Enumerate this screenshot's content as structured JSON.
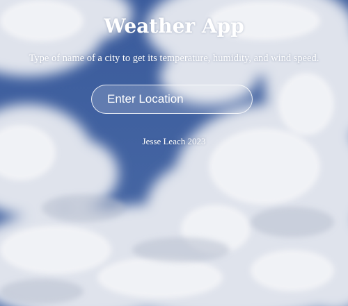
{
  "app": {
    "title": "Weather App",
    "subtitle": "Type of name of a city to get its temperature, humidity, and wind speed.",
    "footer_credit": "Jesse Leach 2023"
  },
  "search": {
    "placeholder": "Enter Location",
    "value": ""
  },
  "background": {
    "description_icon": "cloudy-sky-background",
    "sky_color": "#3d5d9c",
    "cloud_color": "#e8eaf0"
  }
}
